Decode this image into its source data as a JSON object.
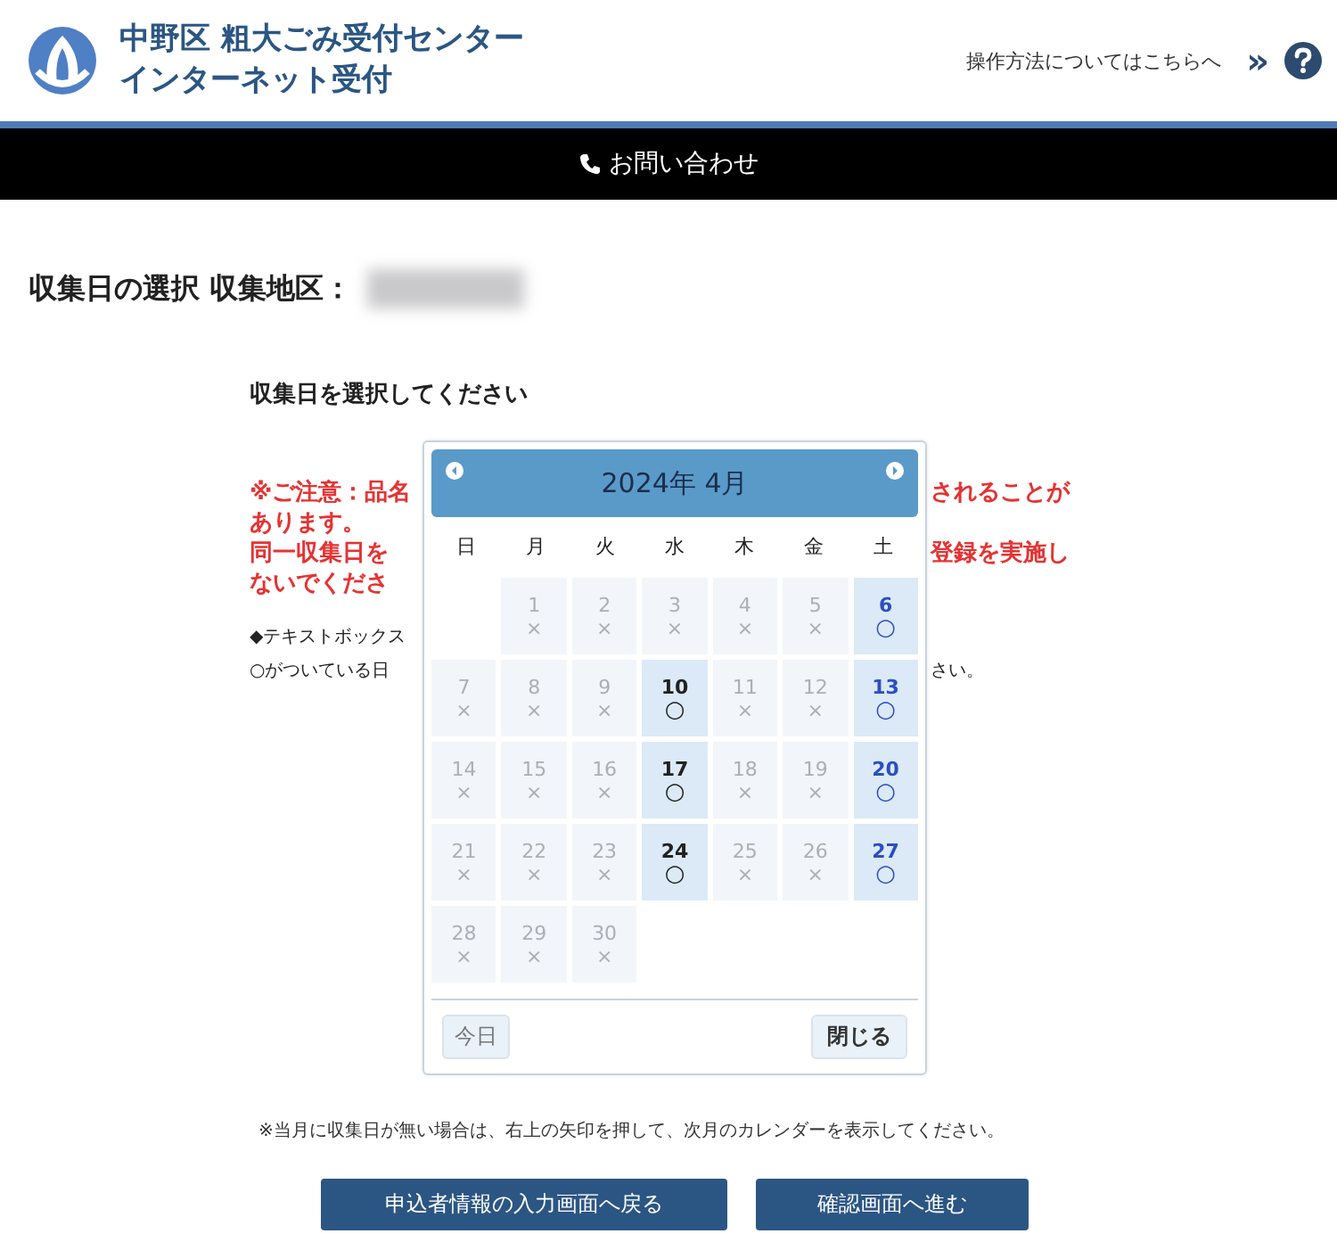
{
  "header": {
    "title_lines": [
      "中野区 粗大ごみ受付センター",
      "インターネット受付"
    ],
    "help_link": "操作方法についてはこちらへ",
    "chevron": "»"
  },
  "contact_bar": {
    "label": "お問い合わせ"
  },
  "heading": "収集日の選択 収集地区：",
  "prompt": "収集日を選択してください",
  "notes": [
    {
      "kind": "warning",
      "left": "※ご注意：品名",
      "right": "されることが"
    },
    {
      "kind": "warning",
      "left": "あります。"
    },
    {
      "kind": "warning",
      "left": "同一収集日を",
      "right": "登録を実施し"
    },
    {
      "kind": "warning",
      "left": "ないでくださ"
    },
    {
      "kind": "info",
      "left": "◆テキストボックス"
    },
    {
      "kind": "info",
      "left": "○がついている日",
      "right": "さい。"
    }
  ],
  "calendar": {
    "title": "2024年 4月",
    "weekdays": [
      "日",
      "月",
      "火",
      "水",
      "木",
      "金",
      "土"
    ],
    "days": [
      {
        "kind": "blank"
      },
      {
        "kind": "day",
        "label": "1",
        "mark": "×",
        "available": false
      },
      {
        "kind": "day",
        "label": "2",
        "mark": "×",
        "available": false
      },
      {
        "kind": "day",
        "label": "3",
        "mark": "×",
        "available": false
      },
      {
        "kind": "day",
        "label": "4",
        "mark": "×",
        "available": false
      },
      {
        "kind": "day",
        "label": "5",
        "mark": "×",
        "available": false
      },
      {
        "kind": "day",
        "label": "6",
        "mark": "○",
        "available": true
      },
      {
        "kind": "day",
        "label": "7",
        "mark": "×",
        "available": false
      },
      {
        "kind": "day",
        "label": "8",
        "mark": "×",
        "available": false
      },
      {
        "kind": "day",
        "label": "9",
        "mark": "×",
        "available": false
      },
      {
        "kind": "day",
        "label": "10",
        "mark": "○",
        "available": true
      },
      {
        "kind": "day",
        "label": "11",
        "mark": "×",
        "available": false
      },
      {
        "kind": "day",
        "label": "12",
        "mark": "×",
        "available": false
      },
      {
        "kind": "day",
        "label": "13",
        "mark": "○",
        "available": true
      },
      {
        "kind": "day",
        "label": "14",
        "mark": "×",
        "available": false
      },
      {
        "kind": "day",
        "label": "15",
        "mark": "×",
        "available": false
      },
      {
        "kind": "day",
        "label": "16",
        "mark": "×",
        "available": false
      },
      {
        "kind": "day",
        "label": "17",
        "mark": "○",
        "available": true
      },
      {
        "kind": "day",
        "label": "18",
        "mark": "×",
        "available": false
      },
      {
        "kind": "day",
        "label": "19",
        "mark": "×",
        "available": false
      },
      {
        "kind": "day",
        "label": "20",
        "mark": "○",
        "available": true
      },
      {
        "kind": "day",
        "label": "21",
        "mark": "×",
        "available": false
      },
      {
        "kind": "day",
        "label": "22",
        "mark": "×",
        "available": false
      },
      {
        "kind": "day",
        "label": "23",
        "mark": "×",
        "available": false
      },
      {
        "kind": "day",
        "label": "24",
        "mark": "○",
        "available": true
      },
      {
        "kind": "day",
        "label": "25",
        "mark": "×",
        "available": false
      },
      {
        "kind": "day",
        "label": "26",
        "mark": "×",
        "available": false
      },
      {
        "kind": "day",
        "label": "27",
        "mark": "○",
        "available": true
      },
      {
        "kind": "day",
        "label": "28",
        "mark": "×",
        "available": false
      },
      {
        "kind": "day",
        "label": "29",
        "mark": "×",
        "available": false
      },
      {
        "kind": "day",
        "label": "30",
        "mark": "×",
        "available": false
      }
    ],
    "today_button": "今日",
    "close_button": "閉じる"
  },
  "footnote": "※当月に収集日が無い場合は、右上の矢印を押して、次月のカレンダーを表示してください。",
  "buttons": [
    "申込者情報の入力画面へ戻る",
    "確認画面へ進む"
  ]
}
